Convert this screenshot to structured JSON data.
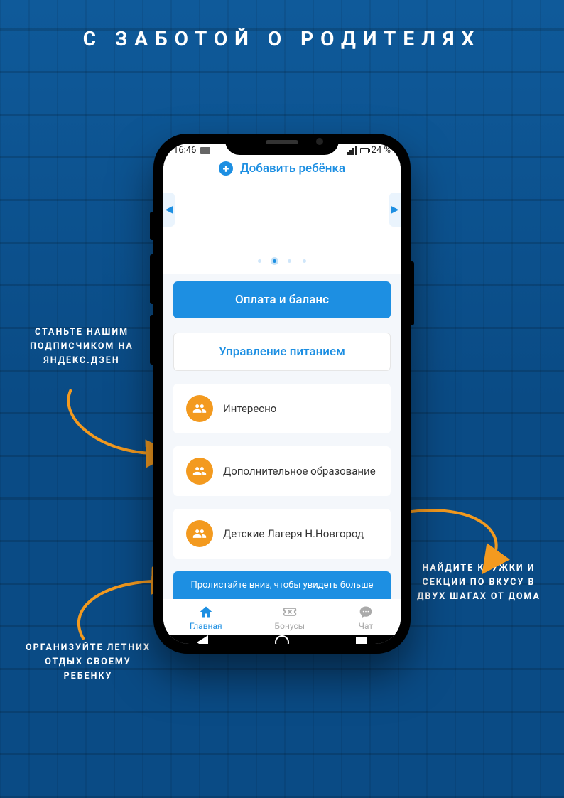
{
  "headline": "С ЗАБОТОЙ О РОДИТЕЛЯХ",
  "statusbar": {
    "time": "16:46",
    "battery": "24 %"
  },
  "header": {
    "add_child": "Добавить ребёнка"
  },
  "buttons": {
    "payment": "Оплата и баланс",
    "nutrition": "Управление питанием"
  },
  "list": {
    "interesting": "Интересно",
    "extra_edu": "Дополнительное образование",
    "camps": "Детские Лагеря Н.Новгород"
  },
  "scroll_hint": "Пролистайте вниз, чтобы увидеть больше",
  "tabs": {
    "home": "Главная",
    "bonus": "Бонусы",
    "chat": "Чат"
  },
  "callouts": {
    "c1": "СТАНЬТЕ НАШИМ ПОДПИСЧИКОМ НА ЯНДЕКС.ДЗЕН",
    "c2": "ОРГАНИЗУЙТЕ ЛЕТНИХ ОТДЫХ СВОЕМУ РЕБЕНКУ",
    "c3": "НАЙДИТЕ КРУЖКИ И СЕКЦИИ ПО ВКУСУ В ДВУХ ШАГАХ ОТ ДОМА"
  }
}
